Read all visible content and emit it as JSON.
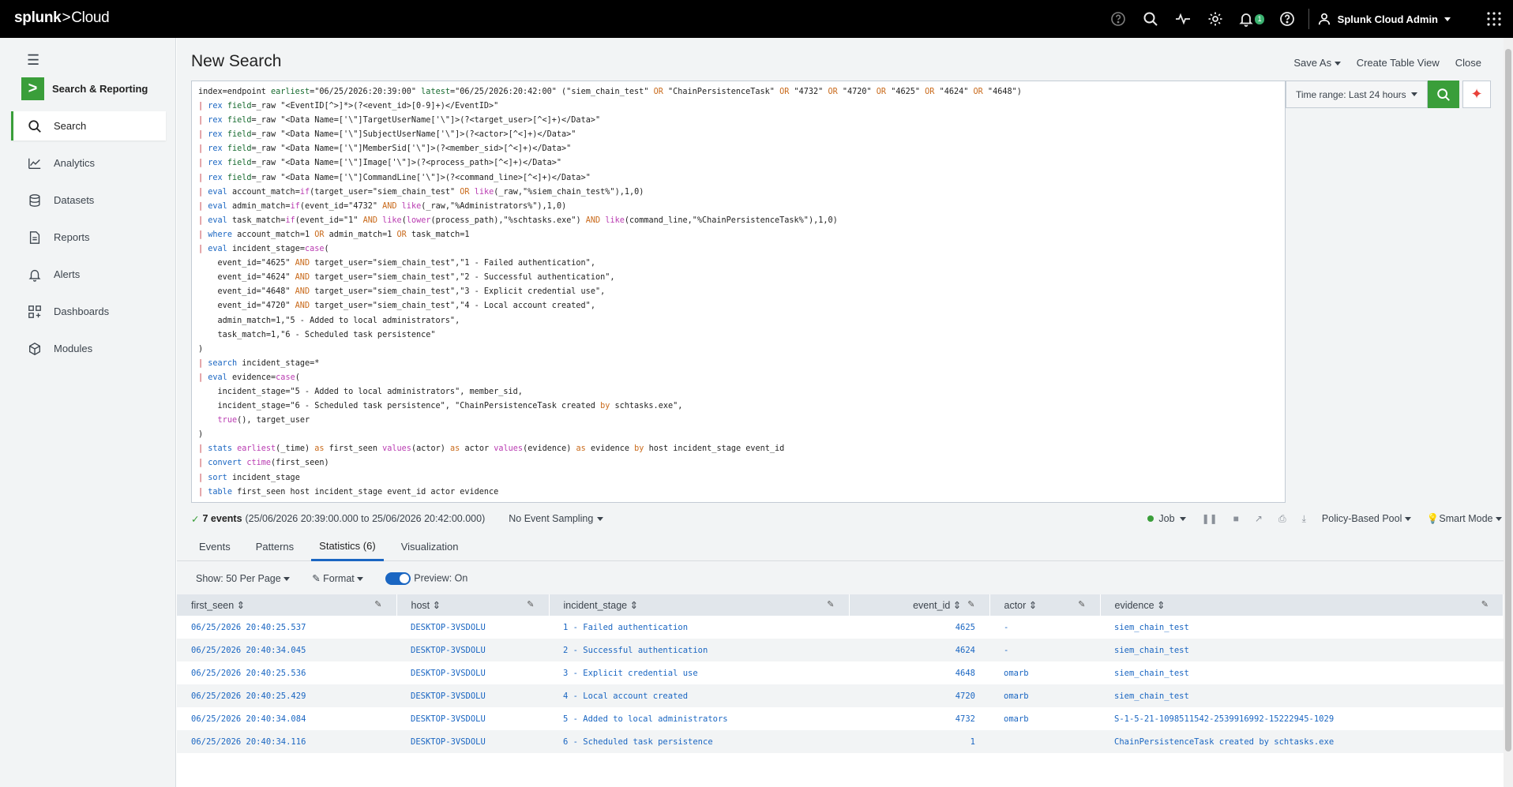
{
  "topbar": {
    "brand": "splunk",
    "brand_suffix": "Cloud",
    "notification_count": "1",
    "user": "Splunk Cloud Admin"
  },
  "sidebar": {
    "app_name": "Search & Reporting",
    "items": [
      {
        "label": "Search",
        "icon": "search-icon"
      },
      {
        "label": "Analytics",
        "icon": "chart-line-icon"
      },
      {
        "label": "Datasets",
        "icon": "database-icon"
      },
      {
        "label": "Reports",
        "icon": "document-icon"
      },
      {
        "label": "Alerts",
        "icon": "bell-icon"
      },
      {
        "label": "Dashboards",
        "icon": "grid-icon"
      },
      {
        "label": "Modules",
        "icon": "cube-icon"
      }
    ]
  },
  "header": {
    "title": "New Search",
    "save_as": "Save As",
    "create_table_view": "Create Table View",
    "close": "Close"
  },
  "search": {
    "time_range": "Time range: Last 24 hours",
    "query_lines": [
      "index=endpoint earliest=\"06/25/2026:20:39:00\" latest=\"06/25/2026:20:42:00\" (\"siem_chain_test\" OR \"ChainPersistenceTask\" OR \"4732\" OR \"4720\" OR \"4625\" OR \"4624\" OR \"4648\")",
      "| rex field=_raw \"<EventID[^>]*>(?<event_id>[0-9]+)</EventID>\"",
      "| rex field=_raw \"<Data Name=['\\\"]TargetUserName['\\\"]>(?<target_user>[^<]+)</Data>\"",
      "| rex field=_raw \"<Data Name=['\\\"]SubjectUserName['\\\"]>(?<actor>[^<]+)</Data>\"",
      "| rex field=_raw \"<Data Name=['\\\"]MemberSid['\\\"]>(?<member_sid>[^<]+)</Data>\"",
      "| rex field=_raw \"<Data Name=['\\\"]Image['\\\"]>(?<process_path>[^<]+)</Data>\"",
      "| rex field=_raw \"<Data Name=['\\\"]CommandLine['\\\"]>(?<command_line>[^<]+)</Data>\"",
      "| eval account_match=if(target_user=\"siem_chain_test\" OR like(_raw,\"%siem_chain_test%\"),1,0)",
      "| eval admin_match=if(event_id=\"4732\" AND like(_raw,\"%Administrators%\"),1,0)",
      "| eval task_match=if(event_id=\"1\" AND like(lower(process_path),\"%schtasks.exe\") AND like(command_line,\"%ChainPersistenceTask%\"),1,0)",
      "| where account_match=1 OR admin_match=1 OR task_match=1",
      "| eval incident_stage=case(",
      "    event_id=\"4625\" AND target_user=\"siem_chain_test\",\"1 - Failed authentication\",",
      "    event_id=\"4624\" AND target_user=\"siem_chain_test\",\"2 - Successful authentication\",",
      "    event_id=\"4648\" AND target_user=\"siem_chain_test\",\"3 - Explicit credential use\",",
      "    event_id=\"4720\" AND target_user=\"siem_chain_test\",\"4 - Local account created\",",
      "    admin_match=1,\"5 - Added to local administrators\",",
      "    task_match=1,\"6 - Scheduled task persistence\"",
      ")",
      "| search incident_stage=*",
      "| eval evidence=case(",
      "    incident_stage=\"5 - Added to local administrators\", member_sid,",
      "    incident_stage=\"6 - Scheduled task persistence\", \"ChainPersistenceTask created by schtasks.exe\",",
      "    true(), target_user",
      ")",
      "| stats earliest(_time) as first_seen values(actor) as actor values(evidence) as evidence by host incident_stage event_id",
      "| convert ctime(first_seen)",
      "| sort incident_stage",
      "| table first_seen host incident_stage event_id actor evidence"
    ]
  },
  "status": {
    "events_count": "7 events",
    "events_range": "(25/06/2026 20:39:00.000 to 25/06/2026 20:42:00.000)",
    "sampling": "No Event Sampling",
    "job": "Job",
    "pool": "Policy-Based Pool",
    "mode": "Smart Mode"
  },
  "tabs": [
    "Events",
    "Patterns",
    "Statistics (6)",
    "Visualization"
  ],
  "toolbar": {
    "per_page": "Show: 50 Per Page",
    "format": "Format",
    "preview": "Preview: On"
  },
  "table": {
    "columns": [
      "first_seen",
      "host",
      "incident_stage",
      "event_id",
      "actor",
      "evidence"
    ],
    "rows": [
      [
        "06/25/2026 20:40:25.537",
        "DESKTOP-3VSDOLU",
        "1 - Failed authentication",
        "4625",
        "-",
        "siem_chain_test"
      ],
      [
        "06/25/2026 20:40:34.045",
        "DESKTOP-3VSDOLU",
        "2 - Successful authentication",
        "4624",
        "-",
        "siem_chain_test"
      ],
      [
        "06/25/2026 20:40:25.536",
        "DESKTOP-3VSDOLU",
        "3 - Explicit credential use",
        "4648",
        "omarb",
        "siem_chain_test"
      ],
      [
        "06/25/2026 20:40:25.429",
        "DESKTOP-3VSDOLU",
        "4 - Local account created",
        "4720",
        "omarb",
        "siem_chain_test"
      ],
      [
        "06/25/2026 20:40:34.084",
        "DESKTOP-3VSDOLU",
        "5 - Added to local administrators",
        "4732",
        "omarb",
        "S-1-5-21-1098511542-2539916992-15222945-1029"
      ],
      [
        "06/25/2026 20:40:34.116",
        "DESKTOP-3VSDOLU",
        "6 - Scheduled task persistence",
        "1",
        "",
        "ChainPersistenceTask created by schtasks.exe"
      ]
    ]
  },
  "colors": {
    "accent_green": "#3a9e3a",
    "link_blue": "#1a66c2",
    "topbar": "#000000"
  }
}
